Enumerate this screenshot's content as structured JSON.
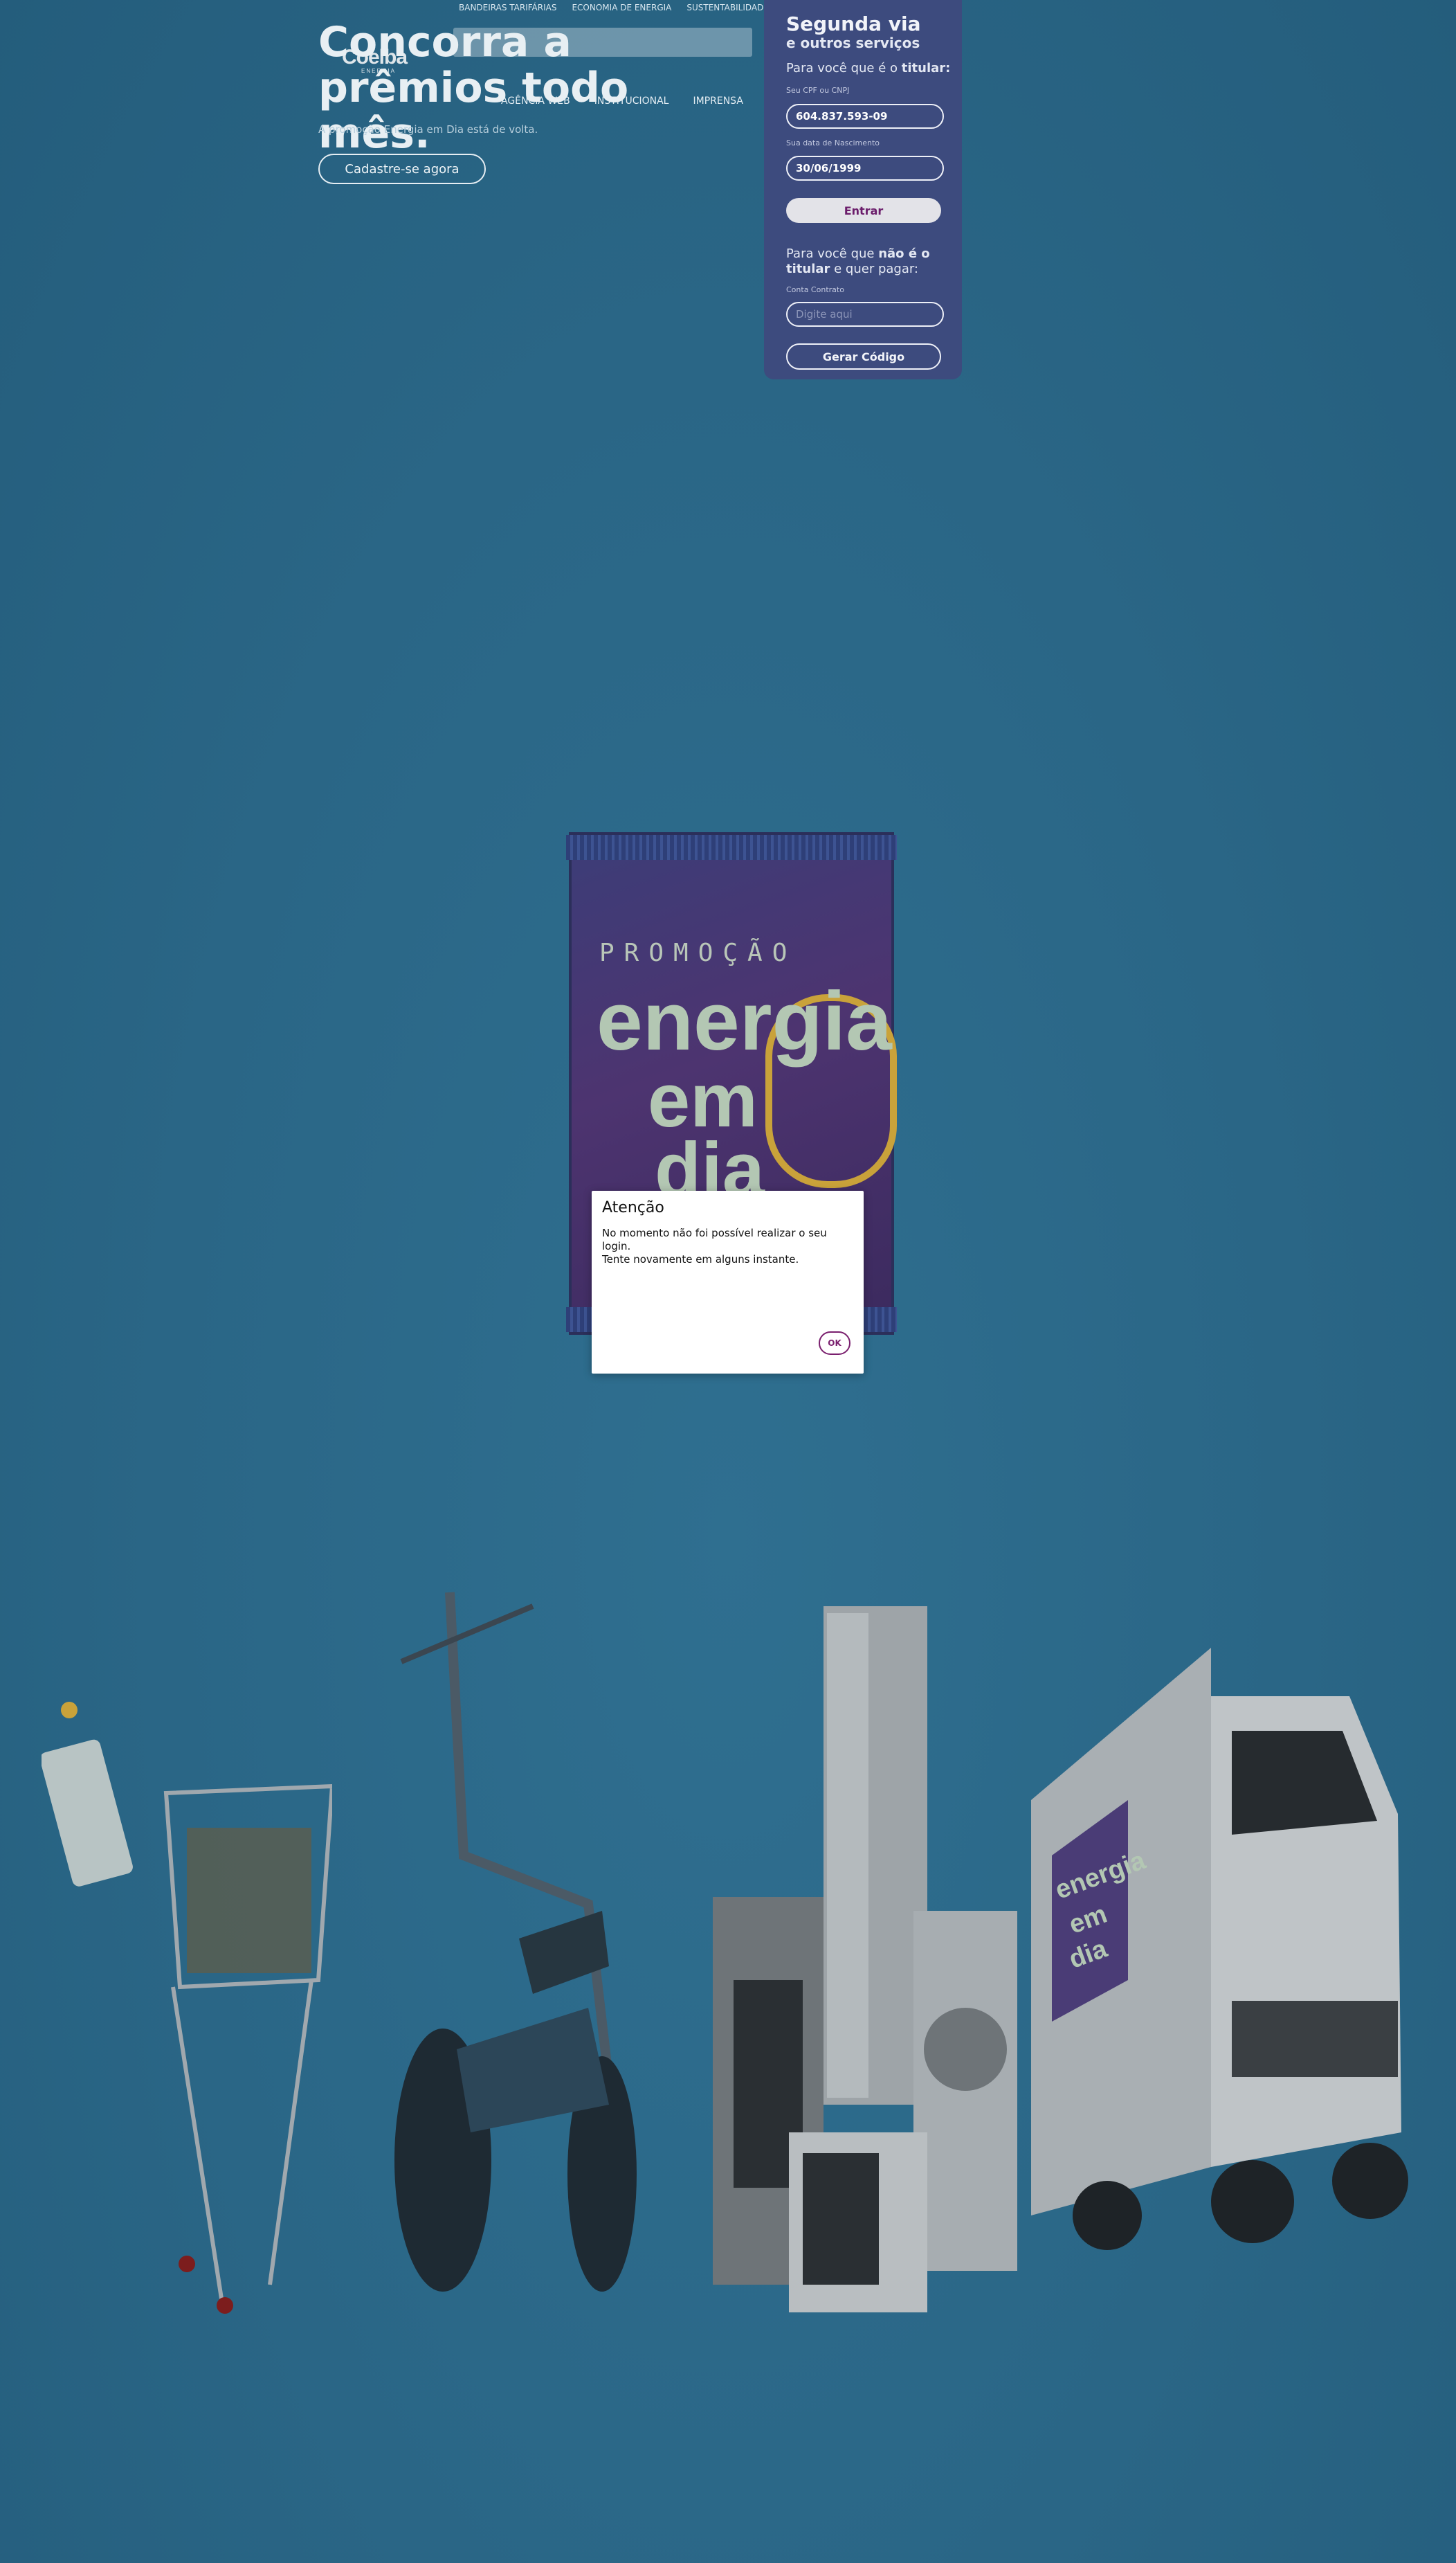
{
  "top_links": [
    "BANDEIRAS TARIFÁRIAS",
    "ECONOMIA DE ENERGIA",
    "SUSTENTABILIDADE"
  ],
  "logo": {
    "name": "Coelba",
    "sub": "ENERGIA"
  },
  "nav": [
    "AGÊNCIA WEB",
    "INSTITUCIONAL",
    "IMPRENSA"
  ],
  "hero": {
    "title": "Concorra a prêmios todo mês.",
    "subtitle": "A promoção Energia em Dia está de volta.",
    "cta": "Cadastre-se agora"
  },
  "panel": {
    "title": "Segunda via",
    "subtitle": "e outros serviços",
    "holder_prefix": "Para você que é o ",
    "holder_bold": "titular:",
    "cpf_label": "Seu CPF ou CNPJ",
    "cpf_value": "604.837.593-09",
    "birth_label": "Sua data de Nascimento",
    "birth_value": "30/06/1999",
    "enter_button": "Entrar",
    "nonholder_prefix": "Para você que ",
    "nonholder_bold1": "não é o titular",
    "nonholder_suffix": " e quer pagar:",
    "contract_label": "Conta Contrato",
    "contract_placeholder": "Digite aqui",
    "code_button": "Gerar Código"
  },
  "banner": {
    "promo": "PROMOÇÃO",
    "line1": "energia",
    "line2": "em",
    "line3": "dia"
  },
  "modal": {
    "title": "Atenção",
    "line1": "No momento não foi possível realizar o seu login.",
    "line2": "Tente novamente em alguns instante.",
    "ok": "OK"
  },
  "truck_banner": {
    "line1": "energia",
    "line2": "em",
    "line3": "dia"
  }
}
